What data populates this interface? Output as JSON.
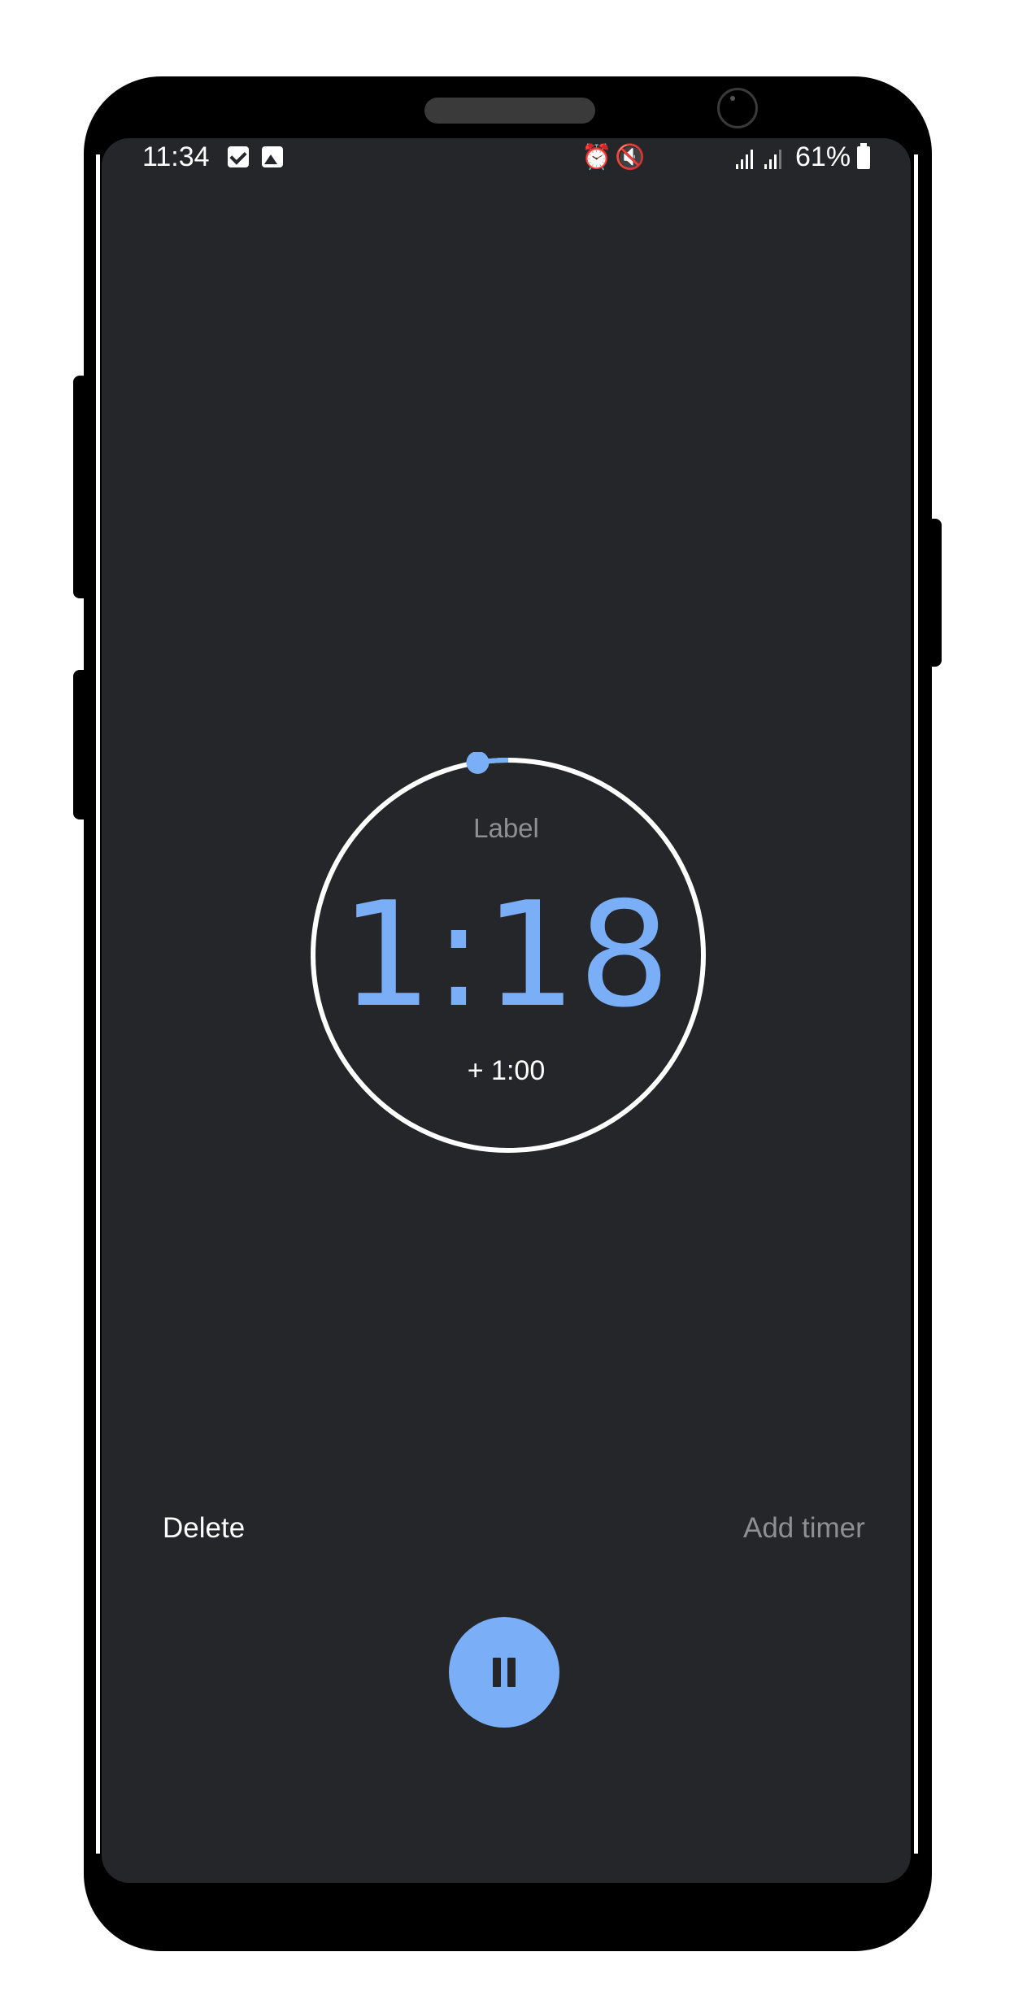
{
  "status_bar": {
    "time": "11:34",
    "battery": "61%",
    "icons": [
      "check-notification-icon",
      "image-notification-icon",
      "alarm-icon",
      "mute-icon",
      "hotspot-icon",
      "4g-icon",
      "signal-icon",
      "signal-icon",
      "battery-charging-icon"
    ]
  },
  "timer": {
    "label": "Label",
    "time": "1:18",
    "add_minute": "+ 1:00",
    "progress_remaining_fraction": 0.975,
    "accent_color": "#7aaff7",
    "ring_color": "#ffffff"
  },
  "actions": {
    "delete": "Delete",
    "pause": "pause-icon",
    "add_timer": "Add timer"
  },
  "colors": {
    "background": "#25262a",
    "text": "#ffffff",
    "muted": "#8e8f93"
  }
}
